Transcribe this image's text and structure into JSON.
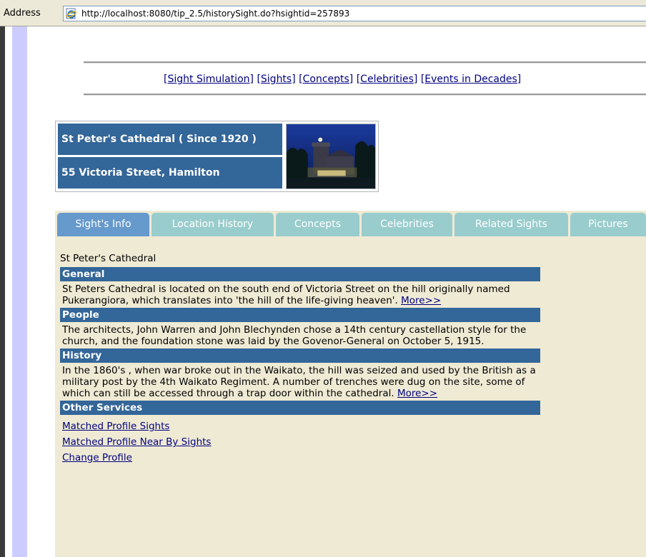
{
  "browser": {
    "address_label": "Address",
    "url": "http://localhost:8080/tip_2.5/historySight.do?hsightid=257893"
  },
  "nav": {
    "links": [
      "[Sight Simulation]",
      "[Sights]",
      "[Concepts]",
      "[Celebrities]",
      "[Events in Decades]"
    ]
  },
  "header": {
    "title": "St Peter's Cathedral ( Since 1920 )",
    "address": "55 Victoria Street, Hamilton"
  },
  "tabs": [
    {
      "label": "Sight's Info",
      "active": true
    },
    {
      "label": "Location History",
      "active": false
    },
    {
      "label": "Concepts",
      "active": false
    },
    {
      "label": "Celebrities",
      "active": false
    },
    {
      "label": "Related Sights",
      "active": false
    },
    {
      "label": "Pictures",
      "active": false
    }
  ],
  "content": {
    "sight_name": "St Peter's Cathedral",
    "general": {
      "heading": "General",
      "text": "St Peters Cathedral is located on the south end of Victoria Street on the hill originally named Pukerangiora, which translates into 'the hill of the life-giving heaven'.",
      "more": "More>>"
    },
    "people": {
      "heading": "People",
      "text": "The architects, John Warren and John Blechynden chose a 14th century castellation style for the church, and the foundation stone was laid by the Govenor-General on October 5, 1915."
    },
    "history": {
      "heading": "History",
      "text": "In the 1860's , when war broke out in the Waikato, the hill was seized and used by the British as a military post by the 4th Waikato Regiment. A number of trenches were dug on the site, some of which can still be accessed through a trap door within the cathedral.",
      "more": "More>>"
    },
    "services": {
      "heading": "Other Services",
      "links": [
        "Matched Profile Sights",
        "Matched Profile Near By Sights",
        "Change Profile"
      ]
    }
  },
  "colors": {
    "header_blue": "#336699",
    "tab_active": "#6699cc",
    "tab_inactive": "#99cccc",
    "content_bg": "#efead4",
    "link": "#000080"
  },
  "icons": {
    "browser_page": "ie-page-icon",
    "photo": "cathedral-photo"
  }
}
